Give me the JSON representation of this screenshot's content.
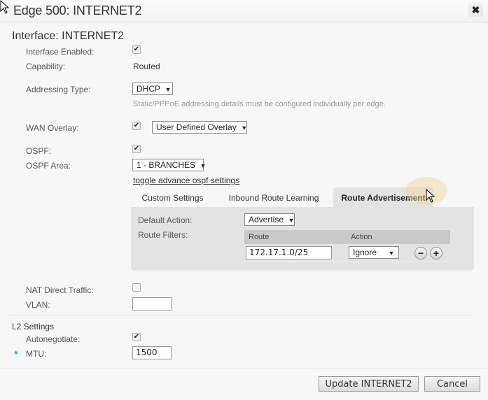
{
  "dialog": {
    "title": "Edge 500: INTERNET2",
    "close_icon": "close-icon"
  },
  "interface": {
    "heading": "Interface: INTERNET2",
    "enabled_label": "Interface Enabled:",
    "enabled": true,
    "capability_label": "Capability:",
    "capability_value": "Routed",
    "addressing_label": "Addressing Type:",
    "addressing_value": "DHCP",
    "addressing_hint": "Static/PPPoE addressing details must be configured individually per edge.",
    "wan_overlay_label": "WAN Overlay:",
    "wan_overlay_checked": true,
    "wan_overlay_value": "User Defined Overlay",
    "ospf_label": "OSPF:",
    "ospf_checked": true,
    "ospf_area_label": "OSPF Area:",
    "ospf_area_value": "1 - BRANCHES",
    "toggle_link": "toggle advance ospf settings"
  },
  "ospf_tabs": [
    {
      "label": "Custom Settings",
      "active": false
    },
    {
      "label": "Inbound Route Learning",
      "active": false
    },
    {
      "label": "Route Advertisement",
      "active": true
    }
  ],
  "route_advertisement": {
    "default_action_label": "Default Action:",
    "default_action_value": "Advertise",
    "route_filters_label": "Route Filters:",
    "columns": [
      "Route",
      "Action"
    ],
    "rows": [
      {
        "route": "172.17.1.0/25",
        "action": "Ignore"
      }
    ],
    "remove_icon": "minus-icon",
    "add_icon": "plus-icon"
  },
  "nat": {
    "label": "NAT Direct Traffic:",
    "checked": false
  },
  "vlan": {
    "label": "VLAN:",
    "value": ""
  },
  "l2": {
    "heading": "L2 Settings",
    "autonegotiate_label": "Autonegotiate:",
    "autonegotiate": true,
    "mtu_label": "MTU:",
    "mtu_value": "1500",
    "required_marker": "*"
  },
  "footer": {
    "update_label": "Update INTERNET2",
    "cancel_label": "Cancel"
  },
  "colors": {
    "required_asterisk": "#1ea4e0",
    "panel_bg": "#e3e3e3",
    "table_header_bg": "#c9c9c9"
  }
}
